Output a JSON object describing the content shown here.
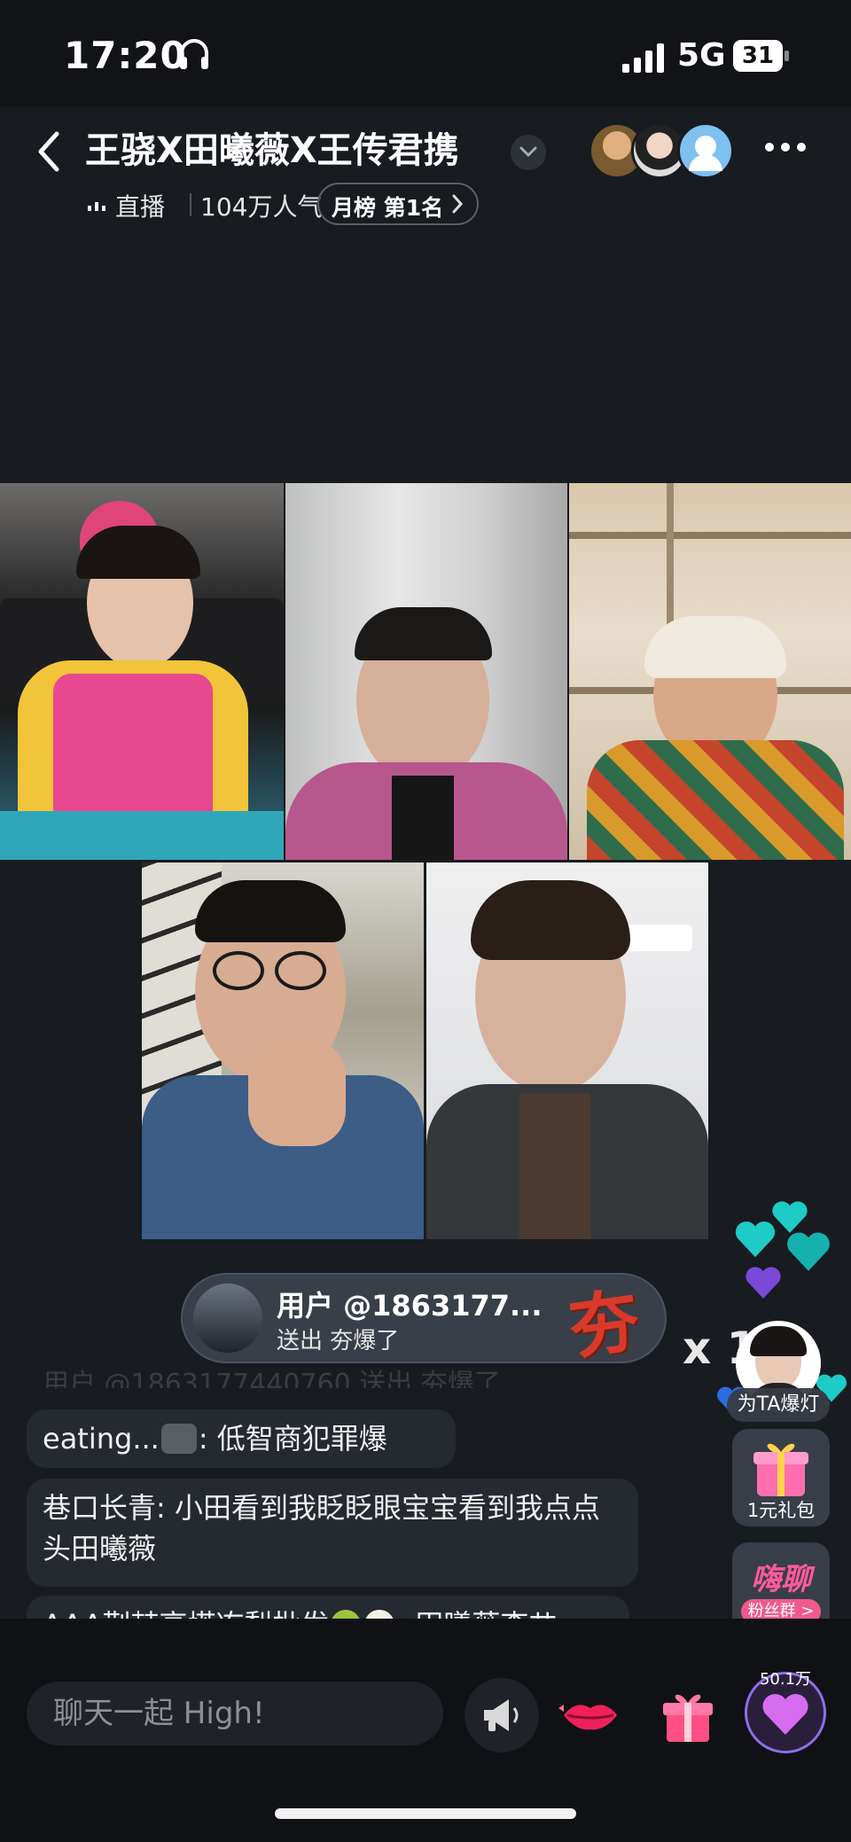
{
  "status_bar": {
    "time": "17:20",
    "network": "5G",
    "battery": "31"
  },
  "header": {
    "title": "王骁X田曦薇X王传君携",
    "live_status": "直播",
    "viewer_count": "104万人气",
    "rank": "月榜 第1名"
  },
  "gift_banner": {
    "user": "用户 @1863177...",
    "action": "送出 夯爆了",
    "gift_glyph": "夯",
    "count": "x 1",
    "faded_comment": "用户 @1863177440760 送出 夯爆了"
  },
  "comments": [
    {
      "user": "eating...",
      "text": ": 低智商犯罪爆"
    },
    {
      "user": "巷口长青",
      "text": ": 小田看到我眨眨眼宝宝看到我点点头田曦薇"
    },
    {
      "user": "AAA荆棘高塔冻梨批发",
      "text": ": 田曦薇李艹"
    }
  ],
  "side_actions": {
    "light_up": "为TA爆灯",
    "red_packet": "1元礼包",
    "fan_group_title": "嗨聊",
    "fan_group_badge": "粉丝群 >"
  },
  "bottom_bar": {
    "chat_placeholder": "聊天一起 High!",
    "like_count": "50.1万"
  },
  "colors": {
    "accent": "#8e6ee8",
    "gift_red": "#d83a2a",
    "heart_teal": "#1ecbc6",
    "fan_pink": "#ff5a9b"
  },
  "icons": [
    "headphone-icon",
    "signal-icon",
    "battery-icon",
    "back-icon",
    "chevron-down-icon",
    "more-icon",
    "chevron-right-icon",
    "horn-icon",
    "lips-icon",
    "gift-icon",
    "heart-icon"
  ]
}
